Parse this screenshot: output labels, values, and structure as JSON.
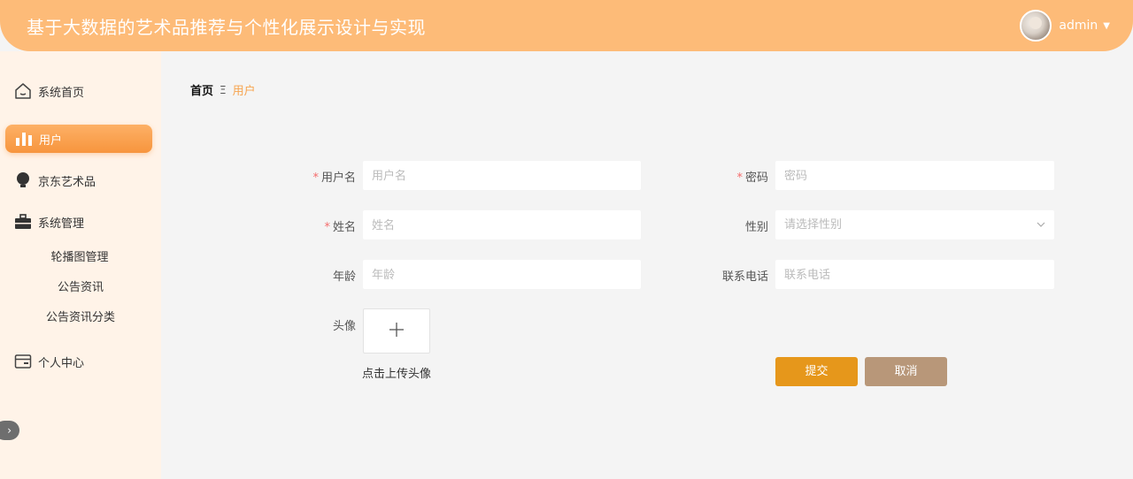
{
  "header": {
    "title": "基于大数据的艺术品推荐与个性化展示设计与实现",
    "username": "admin",
    "avatar_icon": "user-avatar",
    "caret_icon": "caret-down-icon"
  },
  "sidebar": {
    "items": [
      {
        "label": "系统首页",
        "icon": "home-icon"
      },
      {
        "label": "用户",
        "icon": "bar-chart-icon",
        "active": true
      },
      {
        "label": "京东艺术品",
        "icon": "bulb-icon"
      },
      {
        "label": "系统管理",
        "icon": "briefcase-icon"
      },
      {
        "label": "个人中心",
        "icon": "wallet-icon"
      }
    ],
    "sub_items": [
      "轮播图管理",
      "公告资讯",
      "公告资讯分类"
    ],
    "collapse_glyph": "›"
  },
  "breadcrumb": {
    "home": "首页",
    "separator": "Ξ",
    "current": "用户"
  },
  "form": {
    "username": {
      "label": "用户名",
      "placeholder": "用户名",
      "required": true
    },
    "password": {
      "label": "密码",
      "placeholder": "密码",
      "required": true
    },
    "name": {
      "label": "姓名",
      "placeholder": "姓名",
      "required": true
    },
    "gender": {
      "label": "性别",
      "placeholder": "请选择性别",
      "required": false
    },
    "age": {
      "label": "年龄",
      "placeholder": "年龄",
      "required": false
    },
    "phone": {
      "label": "联系电话",
      "placeholder": "联系电话",
      "required": false
    },
    "avatar": {
      "label": "头像",
      "upload_text": "点击上传头像",
      "plus": "+"
    },
    "required_mark": "*"
  },
  "buttons": {
    "submit": "提交",
    "cancel": "取消"
  },
  "colors": {
    "header_bg": "#fdbb78",
    "sidebar_bg": "#fff3e8",
    "active_item": "#f7953d",
    "breadcrumb_current": "#f7a44f",
    "submit": "#e6971b",
    "cancel": "#b89779",
    "required": "#f56c6c"
  }
}
